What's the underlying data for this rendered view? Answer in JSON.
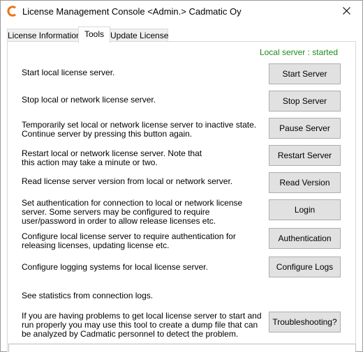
{
  "window": {
    "title": "License Management Console <Admin.> Cadmatic Oy"
  },
  "tabs": [
    {
      "label": "License Information"
    },
    {
      "label": "Tools"
    },
    {
      "label": "Update License"
    }
  ],
  "status": {
    "text": "Local server : started",
    "color": "#1a8a1a"
  },
  "rows": [
    {
      "description": "Start local license server.",
      "button": "Start Server"
    },
    {
      "description": "Stop local or network license server.",
      "button": "Stop Server"
    },
    {
      "description": "Temporarily set local or network license server to inactive state. Continue server by pressing this button again.",
      "button": "Pause Server"
    },
    {
      "description": "Restart local or network license server. Note that this action may take a minute or two.",
      "button": "Restart Server"
    },
    {
      "description": "Read license server version from local or network server.",
      "button": "Read Version"
    },
    {
      "description": "Set authentication for connection to local or network license server. Some servers may be configured to require user/password in order to allow release licenses etc.",
      "button": "Login"
    },
    {
      "description": "Configure local license server to require authentication for releasing licenses, updating license etc.",
      "button": "Authentication"
    },
    {
      "description": "Configure logging systems for local license server.",
      "button": "Configure Logs"
    },
    {
      "description": "See statistics from connection logs."
    },
    {
      "description": "If you are having problems to get local license server to start and run properly you may use this tool to create a dump file that can be analyzed by Cadmatic personnel to detect the problem.",
      "button": "Troubleshooting?"
    }
  ],
  "icons": {
    "app": "cadmatic-logo-icon",
    "close": "close-icon"
  }
}
